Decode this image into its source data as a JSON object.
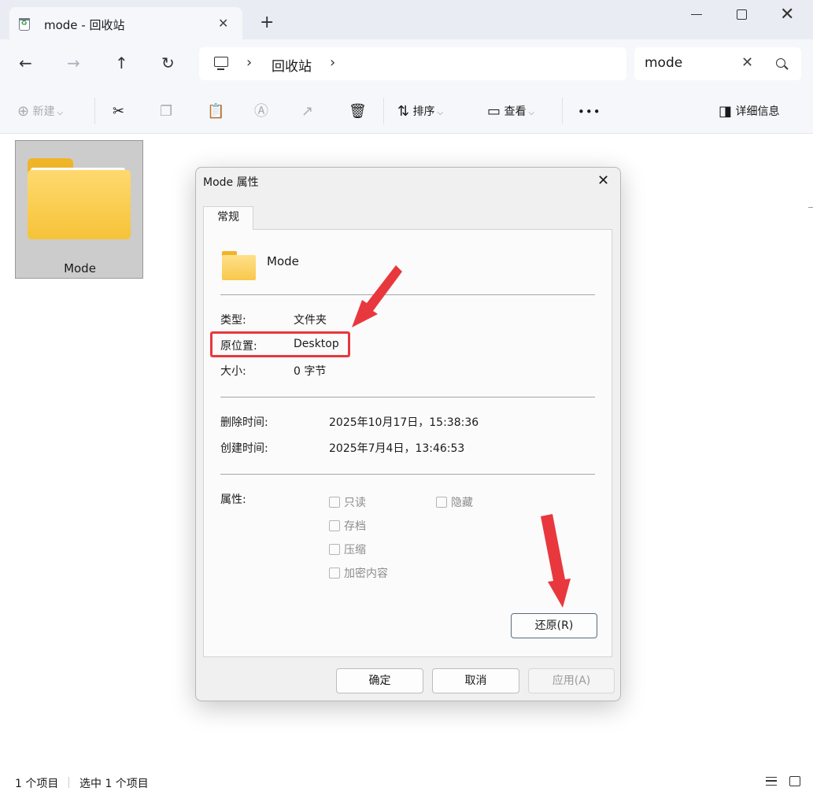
{
  "window": {
    "tab_title": "mode - 回收站",
    "tab_close": "✕",
    "new_tab": "+",
    "minimize": "—",
    "close": "✕"
  },
  "nav": {
    "back": "←",
    "forward": "→",
    "up": "↑",
    "refresh": "↻",
    "breadcrumb": [
      "回收站"
    ],
    "sep": "›",
    "search_value": "mode",
    "search_clear": "✕"
  },
  "toolbar": {
    "new_label": "新建",
    "sort_label": "排序",
    "view_label": "查看",
    "more_label": "•••",
    "details_label": "详细信息"
  },
  "files": [
    {
      "name": "Mode",
      "type": "folder",
      "selected": true
    }
  ],
  "status": {
    "item_count": "1 个项目",
    "selected_count": "选中 1 个项目"
  },
  "dialog": {
    "title": "Mode 属性",
    "close": "✕",
    "tab_general": "常规",
    "name": "Mode",
    "type_label": "类型:",
    "type_value": "文件夹",
    "location_label": "原位置:",
    "location_value": "Desktop",
    "size_label": "大小:",
    "size_value": "0 字节",
    "deleted_label": "删除时间:",
    "deleted_value": "2025年10月17日，15:38:36",
    "created_label": "创建时间:",
    "created_value": "2025年7月4日，13:46:53",
    "attributes_label": "属性:",
    "attributes": {
      "readonly": "只读",
      "hidden": "隐藏",
      "archive": "存档",
      "compress": "压缩",
      "encrypt": "加密内容"
    },
    "restore_button": "还原(R)",
    "ok_button": "确定",
    "cancel_button": "取消",
    "apply_button": "应用(A)"
  },
  "colors": {
    "annotation": "#e8383d",
    "folder": "#f6c338",
    "chrome": "#e9edf3"
  }
}
